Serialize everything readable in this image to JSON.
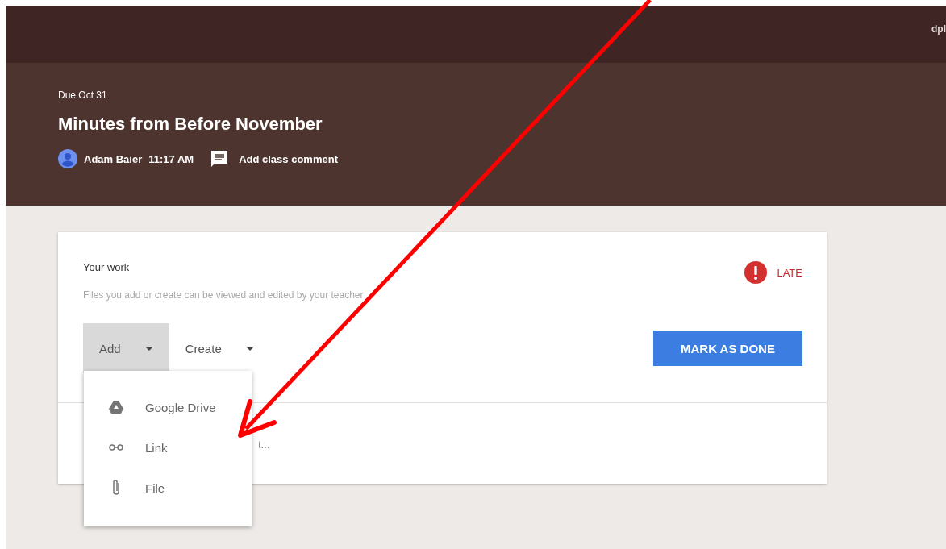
{
  "top_bar": {
    "user_text": "dpl"
  },
  "header": {
    "due": "Due Oct 31",
    "title": "Minutes from Before November",
    "author": "Adam Baier",
    "time": "11:17 AM",
    "comment_link": "Add class comment"
  },
  "your_work": {
    "heading": "Your work",
    "status": "LATE",
    "hint": "Files you add or create can be viewed and edited by your teacher",
    "buttons": [
      {
        "label": "Add",
        "selected": true
      },
      {
        "label": "Create",
        "selected": false
      }
    ],
    "primary_button": "MARK AS DONE",
    "comment_hint": "t..."
  },
  "menu": {
    "items": [
      {
        "kind": "drive",
        "label": "Google Drive"
      },
      {
        "kind": "link",
        "label": "Link"
      },
      {
        "kind": "file",
        "label": "File"
      }
    ]
  },
  "annotation": {
    "kind": "arrow"
  }
}
